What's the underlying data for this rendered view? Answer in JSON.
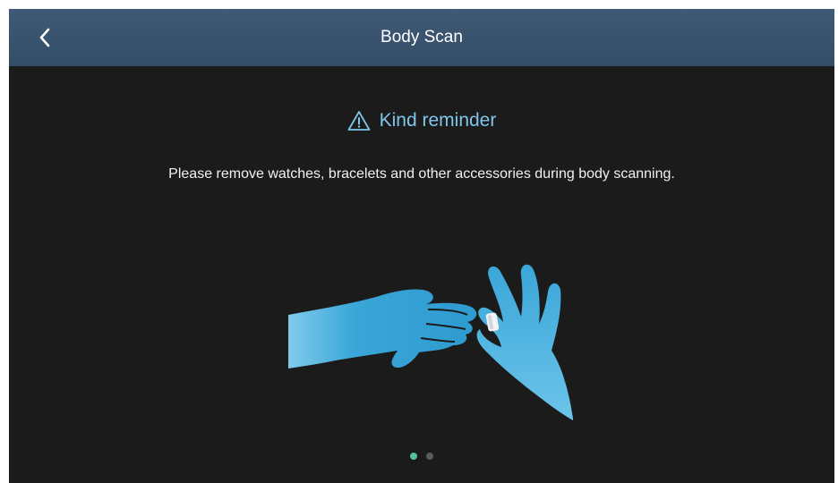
{
  "header": {
    "title": "Body Scan",
    "back_icon": "chevron-left-icon"
  },
  "reminder": {
    "icon": "warning-triangle-icon",
    "text": "Kind reminder"
  },
  "message": "Please remove watches, bracelets and other accessories during body scanning.",
  "illustration": {
    "icon": "hands-removing-ring-illustration"
  },
  "pager": {
    "total": 2,
    "active_index": 0
  },
  "colors": {
    "background": "#1c1b1c",
    "header": "#3f5a76",
    "accent": "#7fc6ea",
    "hand": "#3fa9d9",
    "dot_active": "#4fc3a1",
    "dot_inactive": "#5a5a5a"
  }
}
